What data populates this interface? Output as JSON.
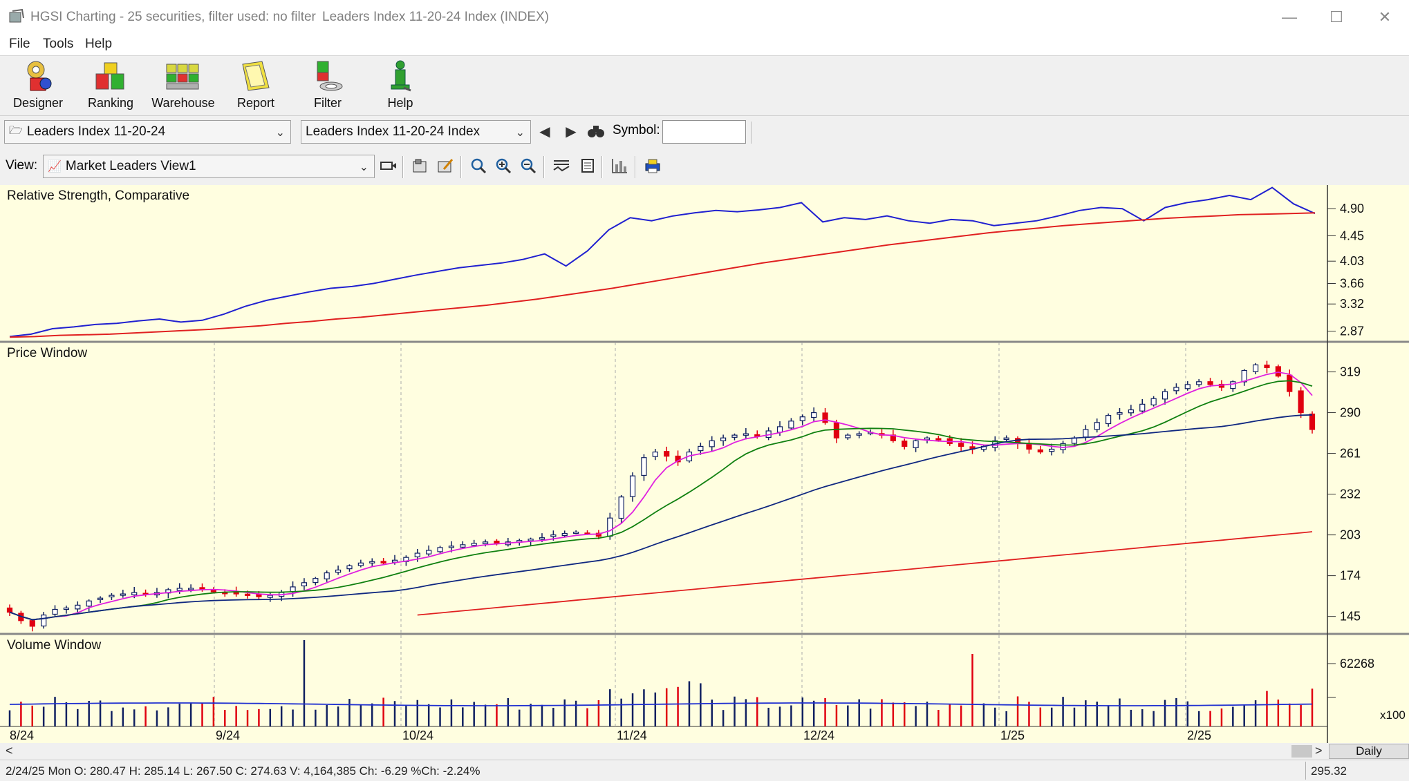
{
  "window": {
    "title": "HGSI Charting - 25 securities, filter used: no filter",
    "subtitle": "Leaders Index 11-20-24 Index (INDEX)",
    "minimize": "—",
    "maximize": "☐",
    "close": "✕"
  },
  "menu": [
    "File",
    "Tools",
    "Help"
  ],
  "toolbar": [
    {
      "label": "Designer",
      "icon": "designer-icon"
    },
    {
      "label": "Ranking",
      "icon": "ranking-icon"
    },
    {
      "label": "Warehouse",
      "icon": "warehouse-icon"
    },
    {
      "label": "Report",
      "icon": "report-icon"
    },
    {
      "label": "Filter",
      "icon": "filter-icon"
    },
    {
      "label": "Help",
      "icon": "help-icon"
    }
  ],
  "selectors": {
    "list_combo": "Leaders Index 11-20-24",
    "security_combo": "Leaders Index 11-20-24 Index",
    "symbol_label": "Symbol:",
    "symbol_value": "",
    "view_label": "View:",
    "view_combo": "Market Leaders View1"
  },
  "panels": {
    "rs_title": "Relative Strength, Comparative",
    "price_title": "Price Window",
    "volume_title": "Volume Window",
    "volume_unit": "x100"
  },
  "chart_data": [
    {
      "type": "line",
      "title": "Relative Strength, Comparative",
      "ylim": [
        2.75,
        5.2
      ],
      "y_ticks": [
        "4.90",
        "4.45",
        "4.03",
        "3.66",
        "3.32",
        "2.87"
      ],
      "series": [
        {
          "color": "#2020d0",
          "values": [
            2.78,
            2.82,
            2.91,
            2.94,
            2.98,
            3.0,
            3.04,
            3.07,
            3.02,
            3.05,
            3.15,
            3.28,
            3.38,
            3.45,
            3.52,
            3.58,
            3.61,
            3.66,
            3.73,
            3.8,
            3.86,
            3.92,
            3.96,
            4.0,
            4.06,
            4.15,
            3.95,
            4.2,
            4.55,
            4.75,
            4.7,
            4.78,
            4.83,
            4.87,
            4.85,
            4.88,
            4.92,
            5.0,
            4.68,
            4.75,
            4.72,
            4.78,
            4.7,
            4.66,
            4.72,
            4.7,
            4.62,
            4.66,
            4.7,
            4.78,
            4.87,
            4.92,
            4.9,
            4.7,
            4.92,
            5.0,
            5.05,
            5.12,
            5.05,
            5.25,
            4.98,
            4.82
          ]
        },
        {
          "color": "#e02020",
          "values": [
            2.77,
            2.78,
            2.8,
            2.81,
            2.82,
            2.84,
            2.86,
            2.88,
            2.9,
            2.93,
            2.96,
            3.0,
            3.03,
            3.07,
            3.1,
            3.14,
            3.18,
            3.22,
            3.26,
            3.3,
            3.35,
            3.4,
            3.46,
            3.52,
            3.58,
            3.65,
            3.72,
            3.79,
            3.86,
            3.93,
            4.0,
            4.06,
            4.12,
            4.18,
            4.24,
            4.3,
            4.35,
            4.4,
            4.45,
            4.5,
            4.54,
            4.58,
            4.62,
            4.65,
            4.68,
            4.71,
            4.74,
            4.76,
            4.78,
            4.8,
            4.81,
            4.82,
            4.83
          ]
        }
      ]
    },
    {
      "type": "candlestick",
      "title": "Price Window",
      "ylim": [
        135,
        335
      ],
      "y_ticks": [
        "319",
        "290",
        "261",
        "232",
        "203",
        "174",
        "145"
      ],
      "x_ticks": [
        "8/24",
        "9/24",
        "10/24",
        "11/24",
        "12/24",
        "1/25",
        "2/25"
      ],
      "closes": [
        148,
        142,
        138,
        146,
        150,
        151,
        153,
        156,
        158,
        160,
        161,
        162,
        161,
        162,
        164,
        165,
        165,
        164,
        163,
        162,
        161,
        160,
        159,
        160,
        162,
        166,
        169,
        172,
        176,
        178,
        181,
        183,
        184,
        183,
        185,
        187,
        190,
        192,
        194,
        195,
        196,
        197,
        198,
        197,
        198,
        199,
        200,
        201,
        203,
        204,
        205,
        204,
        202,
        215,
        230,
        245,
        258,
        262,
        259,
        255,
        262,
        266,
        270,
        272,
        274,
        275,
        273,
        277,
        280,
        284,
        287,
        290,
        283,
        272,
        274,
        275,
        276,
        274,
        270,
        266,
        270,
        272,
        271,
        268,
        266,
        264,
        266,
        270,
        272,
        268,
        264,
        262,
        264,
        268,
        272,
        278,
        283,
        288,
        290,
        292,
        296,
        300,
        305,
        308,
        310,
        312,
        310,
        308,
        312,
        320,
        324,
        322,
        316,
        305,
        290,
        278
      ],
      "ma_series": [
        {
          "color": "#e020e0",
          "name": "",
          "period_hint": "short"
        },
        {
          "color": "#108010",
          "name": "",
          "period_hint": "medium"
        },
        {
          "color": "#102880",
          "name": "",
          "period_hint": "long"
        },
        {
          "color": "#e02020",
          "name": "",
          "period_hint": "very long"
        }
      ],
      "last_value": "295.32"
    },
    {
      "type": "bar",
      "title": "Volume Window",
      "y_ticks": [
        "62268"
      ],
      "unit": "x100"
    }
  ],
  "scroll": {
    "left_arrow": "<",
    "right_arrow": ">",
    "period": "Daily"
  },
  "status": {
    "text": "2/24/25 Mon O: 280.47 H: 285.14 L: 267.50 C: 274.63 V: 4,164,385 Ch: -6.29 %Ch: -2.24%",
    "right_value": "295.32"
  }
}
